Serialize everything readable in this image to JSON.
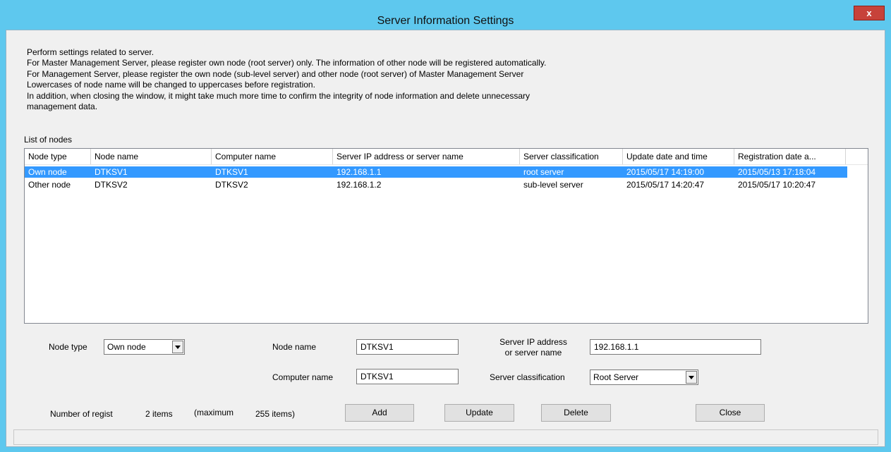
{
  "window": {
    "title": "Server Information Settings",
    "close_glyph": "x"
  },
  "description": [
    "Perform settings related to server.",
    "For Master Management Server, please register own node (root server) only. The information of other node will be registered automatically.",
    "For Management Server, please register the own node (sub-level server) and other node (root server) of Master Management Server",
    "Lowercases of node name will be changed to uppercases before registration.",
    "In addition, when closing the window, it might take much more time to confirm the integrity of node information and delete unnecessary",
    "management data."
  ],
  "list": {
    "label": "List of nodes",
    "columns": [
      "Node type",
      "Node name",
      "Computer name",
      "Server IP address or server name",
      "Server classification",
      "Update date and time",
      "Registration date a..."
    ],
    "rows": [
      [
        "Own node",
        "DTKSV1",
        "DTKSV1",
        "192.168.1.1",
        "root server",
        "2015/05/17 14:19:00",
        "2015/05/13 17:18:04"
      ],
      [
        "Other node",
        "DTKSV2",
        "DTKSV2",
        "192.168.1.2",
        "sub-level server",
        "2015/05/17 14:20:47",
        "2015/05/17 10:20:47"
      ]
    ],
    "selected_row": 0,
    "selection_color": "#3399ff"
  },
  "form": {
    "node_type_label": "Node type",
    "node_type_value": "Own node",
    "node_name_label": "Node name",
    "node_name_value": "DTKSV1",
    "computer_name_label": "Computer name",
    "computer_name_value": "DTKSV1",
    "server_ip_label_line1": "Server IP address",
    "server_ip_label_line2": "or server name",
    "server_ip_value": "192.168.1.1",
    "server_class_label": "Server classification",
    "server_class_value": "Root Server"
  },
  "footer": {
    "count_label": "Number of regist",
    "count_value": "2 items",
    "max_label": "(maximum",
    "max_value": "255  items)"
  },
  "buttons": {
    "add": "Add",
    "update": "Update",
    "delete": "Delete",
    "close": "Close"
  }
}
